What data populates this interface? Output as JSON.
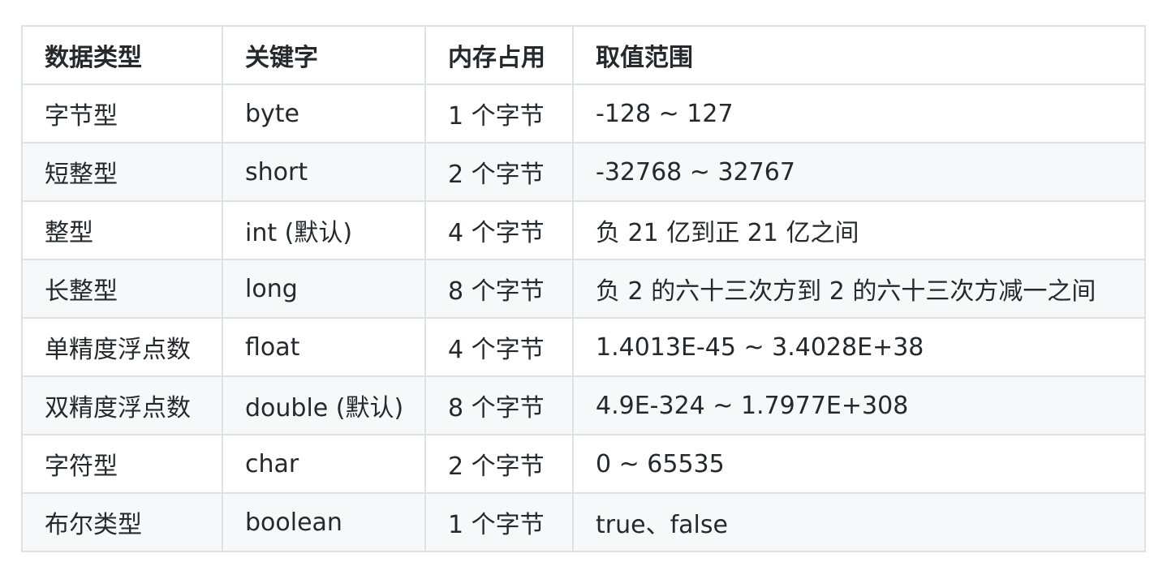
{
  "table": {
    "headers": [
      "数据类型",
      "关键字",
      "内存占用",
      "取值范围"
    ],
    "rows": [
      [
        "字节型",
        "byte",
        "1 个字节",
        "-128 ~ 127"
      ],
      [
        "短整型",
        "short",
        "2 个字节",
        "-32768 ~ 32767"
      ],
      [
        "整型",
        "int (默认)",
        "4 个字节",
        "负 21 亿到正 21 亿之间"
      ],
      [
        "长整型",
        "long",
        "8 个字节",
        "负 2 的六十三次方到 2 的六十三次方减一之间"
      ],
      [
        "单精度浮点数",
        "float",
        "4 个字节",
        "1.4013E-45 ~ 3.4028E+38"
      ],
      [
        "双精度浮点数",
        "double (默认)",
        "8 个字节",
        "4.9E-324 ~ 1.7977E+308"
      ],
      [
        "字符型",
        "char",
        "2 个字节",
        "0 ~ 65535"
      ],
      [
        "布尔类型",
        "boolean",
        "1 个字节",
        "true、false"
      ]
    ]
  },
  "colors": {
    "border": "#dfe2e5",
    "stripe": "#f6f8fa",
    "text": "#24292e"
  }
}
